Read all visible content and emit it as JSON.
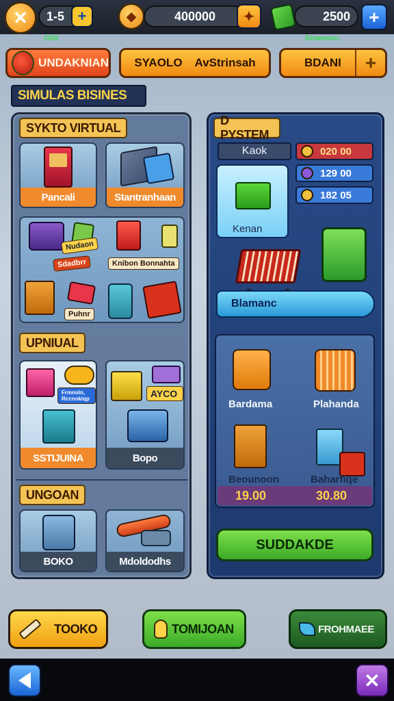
{
  "hud": {
    "level": "1-5",
    "coins": "400000",
    "gems": "2500",
    "gems_sub": "Dowoocu",
    "level_sub": "O2K"
  },
  "tabs": [
    {
      "label": "UNDAKNIAN"
    },
    {
      "label": "SYAOLO",
      "label2": "AvStrinsah"
    },
    {
      "label": "BDANI"
    }
  ],
  "page_title": "SIMULAS BISINES",
  "left_panel": {
    "section1": "SYKTO VIRTUAL",
    "card1": "Pancali",
    "card2": "Stantranhaan",
    "sticker1": "Nudaon",
    "sticker2": "Sdadbrr",
    "sticker3": "Knibon Bonnahta",
    "sticker4": "Puhnr",
    "section2": "UPNIUAL",
    "card3": "SSTIJUINA",
    "card3_tag": "Frmnoln, Rccnokiqp",
    "card4": "Bopo",
    "card4_tag": "AYCO",
    "section3": "UNGOAN",
    "card5": "BOKO",
    "card6": "Mdoldodhs"
  },
  "right_panel": {
    "section": "D PYSTEM",
    "subtitle": "Kaok",
    "prices": [
      "020 00",
      "129 00",
      "182 05"
    ],
    "highlight_label": "Kenan",
    "cart_label": "Blamanc",
    "item1": "Bardama",
    "item2": "Plahanda",
    "item3": "Beounoon",
    "item4": "Baharfiqe",
    "price1": "19.00",
    "price2": "30.80",
    "action": "SUDDAKDE"
  },
  "bottom": {
    "btn1": "TOOKO",
    "btn2": "TOMIJOAN",
    "btn3": "FROHMAEE"
  },
  "colors": {
    "accent_orange": "#f08a12",
    "accent_green": "#3caa28",
    "panel_blue": "#1d3a6e"
  }
}
